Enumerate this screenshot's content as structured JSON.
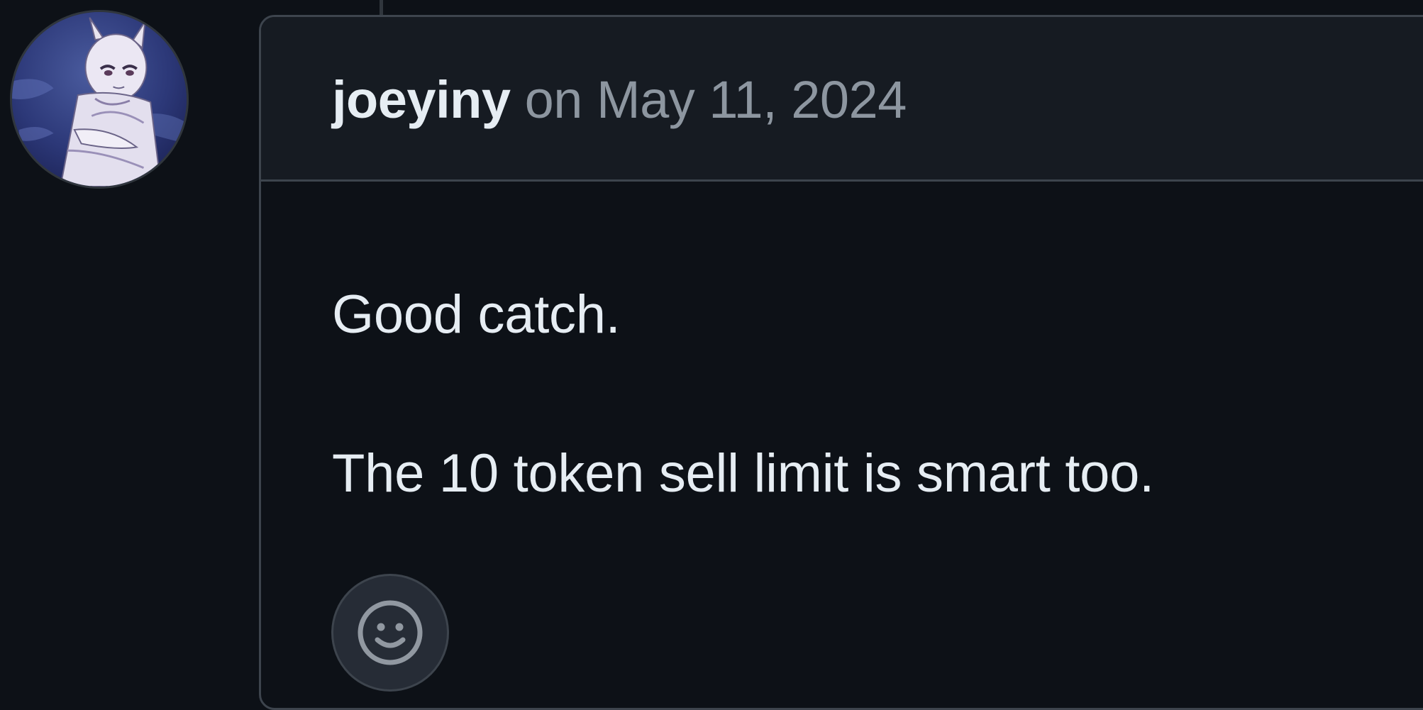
{
  "comment": {
    "author": "joeyiny",
    "on_label": "on",
    "timestamp": "May 11, 2024",
    "body_lines": [
      "Good catch.",
      "The 10 token sell limit is smart too."
    ],
    "avatar_icon": "avatar-image",
    "reaction_icon": "smiley-icon"
  },
  "colors": {
    "background": "#0d1117",
    "header_background": "#161b22",
    "border": "#3d444d",
    "primary_text": "#e6edf3",
    "muted_text": "#8d96a0"
  }
}
